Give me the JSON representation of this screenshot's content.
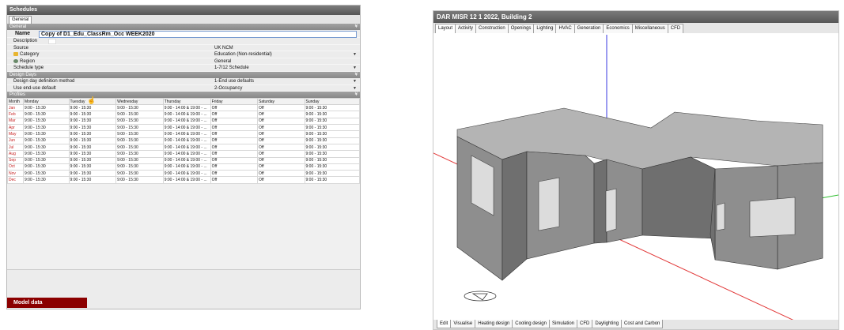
{
  "schedules": {
    "window_title": "Schedules",
    "tabs": [
      "General"
    ],
    "general": {
      "header": "General",
      "name_label": "Name",
      "name_value": "Copy of D1_Edu_ClassRm_Occ WEEK2020",
      "description_label": "Description",
      "source_label": "Source",
      "source_value": "UK NCM",
      "category_label": "Category",
      "category_value": "Education (Non-residential)",
      "region_label": "Region",
      "region_value": "General",
      "schedule_type_label": "Schedule type",
      "schedule_type_value": "1-7/12 Schedule"
    },
    "design_days": {
      "header": "Design Days",
      "method_label": "Design day definition method",
      "method_value": "1-End use defaults",
      "end_use_label": "Use end-use default",
      "end_use_value": "2-Occupancy"
    },
    "profiles": {
      "header": "Profiles",
      "columns": [
        "Month",
        "Monday",
        "Tuesday",
        "Wednesday",
        "Thursday",
        "Friday",
        "Saturday",
        "Sunday"
      ],
      "rows": [
        [
          "Jan",
          "9:00 - 15:30",
          "9:00 - 15:30",
          "9:00 - 15:30",
          "9:00 - 14:00 & 19:00 - ...",
          "Off",
          "Off",
          "9:00 - 15:30"
        ],
        [
          "Feb",
          "9:00 - 15:30",
          "9:00 - 15:30",
          "9:00 - 15:30",
          "9:00 - 14:00 & 19:00 - ...",
          "Off",
          "Off",
          "9:00 - 15:30"
        ],
        [
          "Mar",
          "9:00 - 15:30",
          "9:00 - 15:30",
          "9:00 - 15:30",
          "9:00 - 14:00 & 19:00 - ...",
          "Off",
          "Off",
          "9:00 - 15:30"
        ],
        [
          "Apr",
          "9:00 - 15:30",
          "9:00 - 15:30",
          "9:00 - 15:30",
          "9:00 - 14:00 & 19:00 - ...",
          "Off",
          "Off",
          "9:00 - 15:30"
        ],
        [
          "May",
          "9:00 - 15:30",
          "9:00 - 15:30",
          "9:00 - 15:30",
          "9:00 - 14:00 & 19:00 - ...",
          "Off",
          "Off",
          "9:00 - 15:30"
        ],
        [
          "Jun",
          "9:00 - 15:30",
          "9:00 - 15:30",
          "9:00 - 15:30",
          "9:00 - 14:00 & 19:00 - ...",
          "Off",
          "Off",
          "9:00 - 15:30"
        ],
        [
          "Jul",
          "9:00 - 15:30",
          "9:00 - 15:30",
          "9:00 - 15:30",
          "9:00 - 14:00 & 19:00 - ...",
          "Off",
          "Off",
          "9:00 - 15:30"
        ],
        [
          "Aug",
          "9:00 - 15:30",
          "9:00 - 15:30",
          "9:00 - 15:30",
          "9:00 - 14:00 & 19:00 - ...",
          "Off",
          "Off",
          "9:00 - 15:30"
        ],
        [
          "Sep",
          "9:00 - 15:30",
          "9:00 - 15:30",
          "9:00 - 15:30",
          "9:00 - 14:00 & 19:00 - ...",
          "Off",
          "Off",
          "9:00 - 15:30"
        ],
        [
          "Oct",
          "9:00 - 15:30",
          "9:00 - 15:30",
          "9:00 - 15:30",
          "9:00 - 14:00 & 19:00 - ...",
          "Off",
          "Off",
          "9:00 - 15:30"
        ],
        [
          "Nov",
          "9:00 - 15:30",
          "9:00 - 15:30",
          "9:00 - 15:30",
          "9:00 - 14:00 & 19:00 - ...",
          "Off",
          "Off",
          "9:00 - 15:30"
        ],
        [
          "Dec",
          "9:00 - 15:30",
          "9:00 - 15:30",
          "9:00 - 15:30",
          "9:00 - 14:00 & 19:00 - ...",
          "Off",
          "Off",
          "9:00 - 15:30"
        ]
      ]
    },
    "model_data_label": "Model data"
  },
  "viewer": {
    "title": "DAR MISR 12 1  2022, Building 2",
    "top_tabs": [
      "Layout",
      "Activity",
      "Construction",
      "Openings",
      "Lighting",
      "HVAC",
      "Generation",
      "Economics",
      "Miscellaneous",
      "CFD"
    ],
    "active_top_tab": "Layout",
    "bottom_tabs": [
      "Edit",
      "Visualise",
      "Heating design",
      "Cooling design",
      "Simulation",
      "CFD",
      "Daylighting",
      "Cost and Carbon"
    ],
    "active_bottom_tab": "Edit",
    "colors": {
      "x_axis": "#e23a3a",
      "y_axis": "#2fbf2f",
      "z_axis": "#3a3ae0",
      "wall_front": "#8e8e8e",
      "wall_side": "#6f6f6f",
      "roof": "#b4b4b4",
      "window": "#dcdcdc"
    }
  }
}
